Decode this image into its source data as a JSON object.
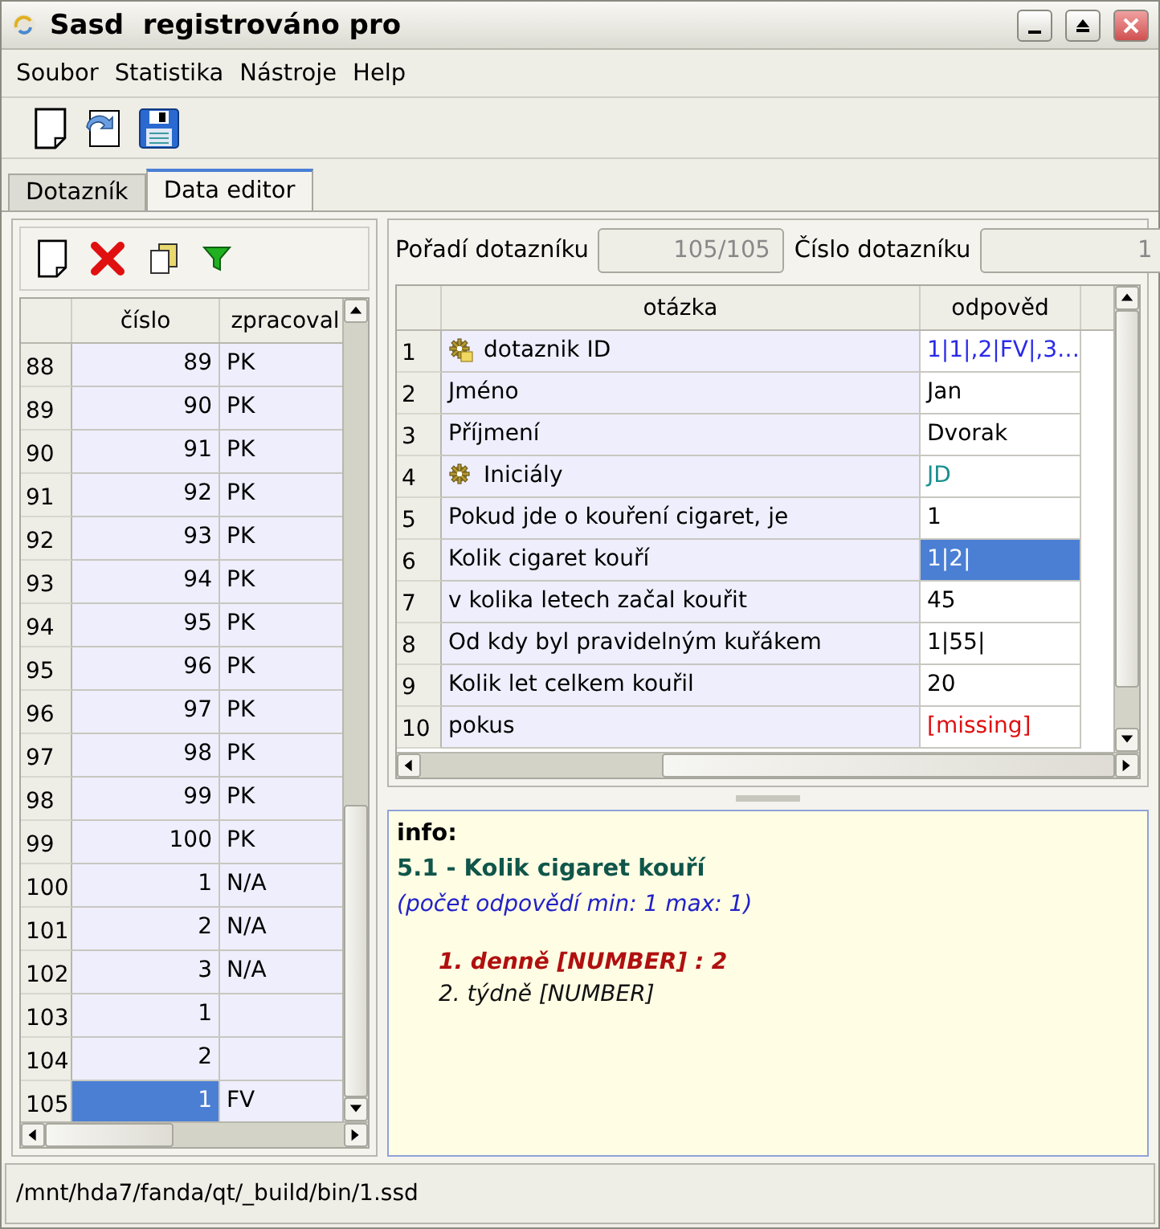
{
  "window": {
    "title": "Sasd  registrováno pro"
  },
  "menu": [
    "Soubor",
    "Statistika",
    "Nástroje",
    "Help"
  ],
  "tabs": [
    {
      "label": "Dotazník",
      "selected": false
    },
    {
      "label": "Data editor",
      "selected": true
    }
  ],
  "list": {
    "columns": [
      "číslo",
      "zpracoval"
    ],
    "rows": [
      {
        "row": "88",
        "cislo": "89",
        "zpracoval": "PK",
        "selected": false
      },
      {
        "row": "89",
        "cislo": "90",
        "zpracoval": "PK",
        "selected": false
      },
      {
        "row": "90",
        "cislo": "91",
        "zpracoval": "PK",
        "selected": false
      },
      {
        "row": "91",
        "cislo": "92",
        "zpracoval": "PK",
        "selected": false
      },
      {
        "row": "92",
        "cislo": "93",
        "zpracoval": "PK",
        "selected": false
      },
      {
        "row": "93",
        "cislo": "94",
        "zpracoval": "PK",
        "selected": false
      },
      {
        "row": "94",
        "cislo": "95",
        "zpracoval": "PK",
        "selected": false
      },
      {
        "row": "95",
        "cislo": "96",
        "zpracoval": "PK",
        "selected": false
      },
      {
        "row": "96",
        "cislo": "97",
        "zpracoval": "PK",
        "selected": false
      },
      {
        "row": "97",
        "cislo": "98",
        "zpracoval": "PK",
        "selected": false
      },
      {
        "row": "98",
        "cislo": "99",
        "zpracoval": "PK",
        "selected": false
      },
      {
        "row": "99",
        "cislo": "100",
        "zpracoval": "PK",
        "selected": false
      },
      {
        "row": "100",
        "cislo": "1",
        "zpracoval": "N/A",
        "selected": false
      },
      {
        "row": "101",
        "cislo": "2",
        "zpracoval": "N/A",
        "selected": false
      },
      {
        "row": "102",
        "cislo": "3",
        "zpracoval": "N/A",
        "selected": false
      },
      {
        "row": "103",
        "cislo": "1",
        "selected": false
      },
      {
        "row": "104",
        "cislo": "2",
        "selected": false
      },
      {
        "row": "105",
        "cislo": "1",
        "zpracoval": "FV",
        "selected": true
      }
    ]
  },
  "fields": [
    {
      "label": "Pořadí dotazníku",
      "value": "105/105"
    },
    {
      "label": "Číslo dotazníku",
      "value": "1"
    }
  ],
  "questions": {
    "columns": [
      "otázka",
      "odpověd"
    ],
    "rows": [
      {
        "row": "1",
        "question": "dotaznik ID",
        "answer": "1|1|,2|FV|,3…",
        "kind": "id",
        "selected": false
      },
      {
        "row": "2",
        "question": "Jméno",
        "answer": "Jan",
        "kind": "plain",
        "selected": false
      },
      {
        "row": "3",
        "question": "Příjmení",
        "answer": "Dvorak",
        "kind": "plain",
        "selected": false
      },
      {
        "row": "4",
        "question": "Iniciály",
        "answer": "JD",
        "kind": "computed",
        "selected": false
      },
      {
        "row": "5",
        "question": "Pokud jde o kouření cigaret, je",
        "answer": "1",
        "kind": "plain",
        "selected": false
      },
      {
        "row": "6",
        "question": "Kolik cigaret kouří",
        "answer": "1|2|",
        "kind": "plain",
        "selected": true
      },
      {
        "row": "7",
        "question": "v kolika letech začal kouřit",
        "answer": "45",
        "kind": "plain",
        "selected": false
      },
      {
        "row": "8",
        "question": "Od kdy byl pravidelným kuřákem",
        "answer": "1|55|",
        "kind": "plain",
        "selected": false
      },
      {
        "row": "9",
        "question": "Kolik let celkem kouřil",
        "answer": "20",
        "kind": "plain",
        "selected": false
      },
      {
        "row": "10",
        "question": "pokus",
        "answer": "[missing]",
        "kind": "missing",
        "selected": false
      }
    ]
  },
  "info": {
    "heading": "info:",
    "question": "5.1 - Kolik cigaret kouří",
    "hint": "(počet odpovědí min: 1 max: 1)",
    "options": [
      {
        "label": "1. denně [NUMBER] : 2",
        "selected": true
      },
      {
        "label": "2. týdně [NUMBER]",
        "selected": false
      }
    ]
  },
  "status_bar": "/mnt/hda7/fanda/qt/_build/bin/1.ssd"
}
